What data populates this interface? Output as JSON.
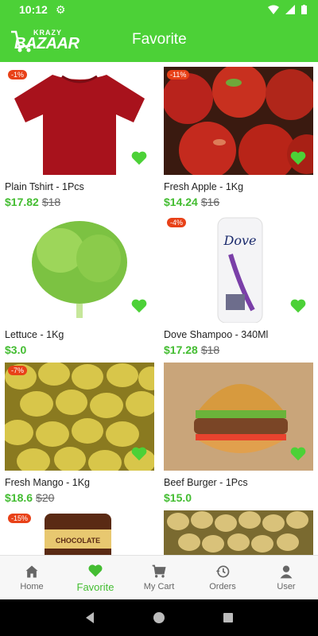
{
  "status_bar": {
    "time": "10:12"
  },
  "app_bar": {
    "logo_small": "KRAZY",
    "logo_big": "BAZAAR",
    "title": "Favorite"
  },
  "colors": {
    "accent": "#4cd137",
    "price": "#44bd32",
    "discount": "#e84118"
  },
  "products": [
    {
      "name": "Plain Tshirt - 1Pcs",
      "price": "$17.82",
      "old_price": "$18",
      "discount": "-1%",
      "image": "tshirt"
    },
    {
      "name": "Fresh Apple - 1Kg",
      "price": "$14.24",
      "old_price": "$16",
      "discount": "-11%",
      "image": "apple"
    },
    {
      "name": "Lettuce - 1Kg",
      "price": "$3.0",
      "old_price": "",
      "discount": "",
      "image": "lettuce"
    },
    {
      "name": "Dove Shampoo - 340Ml",
      "price": "$17.28",
      "old_price": "$18",
      "discount": "-4%",
      "image": "shampoo",
      "brand": "Dove"
    },
    {
      "name": "Fresh Mango - 1Kg",
      "price": "$18.6",
      "old_price": "$20",
      "discount": "-7%",
      "image": "mango"
    },
    {
      "name": "Beef Burger - 1Pcs",
      "price": "$15.0",
      "old_price": "",
      "discount": "",
      "image": "burger"
    },
    {
      "name": "",
      "price": "",
      "old_price": "",
      "discount": "-15%",
      "image": "chocolate",
      "label": "CHOCOLATE"
    },
    {
      "name": "",
      "price": "",
      "old_price": "",
      "discount": "",
      "image": "potato"
    }
  ],
  "bottom_nav": [
    {
      "label": "Home",
      "icon": "home-icon",
      "active": false
    },
    {
      "label": "Favorite",
      "icon": "heart-icon",
      "active": true
    },
    {
      "label": "My Cart",
      "icon": "cart-icon",
      "active": false
    },
    {
      "label": "Orders",
      "icon": "history-icon",
      "active": false
    },
    {
      "label": "User",
      "icon": "user-icon",
      "active": false
    }
  ]
}
